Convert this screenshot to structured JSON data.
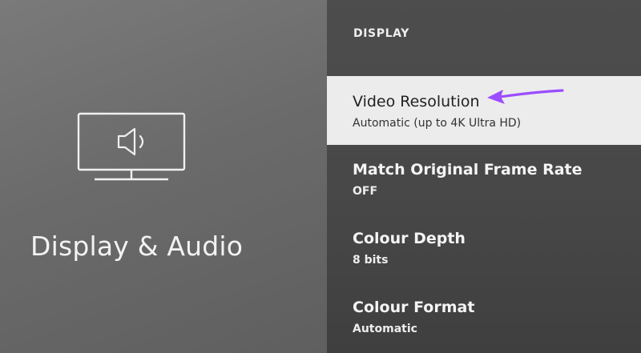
{
  "left": {
    "icon": "tv-speaker-icon",
    "title": "Display & Audio"
  },
  "right": {
    "section_header": "DISPLAY",
    "items": [
      {
        "label": "Video Resolution",
        "value": "Automatic (up to 4K Ultra HD)",
        "focused": true
      },
      {
        "label": "Match Original Frame Rate",
        "value": "OFF",
        "focused": false
      },
      {
        "label": "Colour Depth",
        "value": "8 bits",
        "focused": false
      },
      {
        "label": "Colour Format",
        "value": "Automatic",
        "focused": false
      }
    ]
  },
  "annotation": {
    "icon": "purple-arrow-icon",
    "color": "#9b4dff"
  },
  "colors": {
    "focus_background": "#ececec",
    "panel_dark": "#4a4a4a",
    "panel_light": "#6e6e6e"
  }
}
